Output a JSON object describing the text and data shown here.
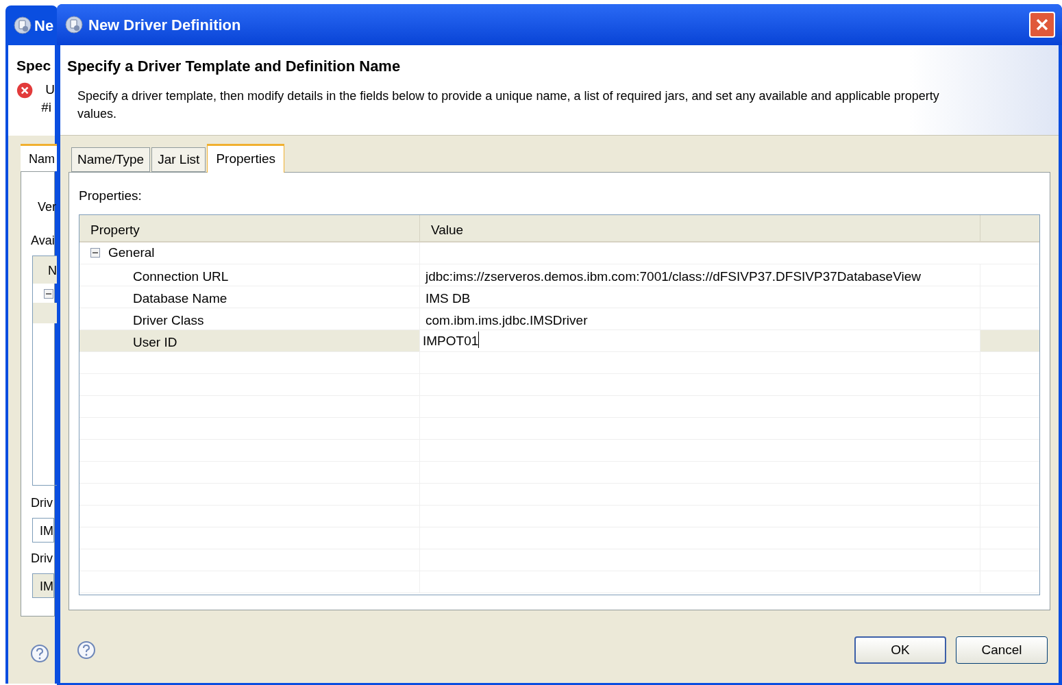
{
  "background_window": {
    "title": "Ne",
    "heading": "Spec",
    "message_lines": [
      "U",
      "#i"
    ],
    "tab": "Nam",
    "label_1": "Ver",
    "label_2": "Avai",
    "table_header": "N",
    "field_label_1": "Driv",
    "field_value_1": "IM",
    "field_label_2": "Driv",
    "field_value_2": "IM"
  },
  "window": {
    "title": "New Driver Definition"
  },
  "header": {
    "title": "Specify a Driver Template and Definition Name",
    "description": "Specify a driver template, then modify details in the fields below to provide a unique name, a list of required jars, and set any available and applicable property values."
  },
  "tabs": [
    {
      "label": "Name/Type",
      "selected": false
    },
    {
      "label": "Jar List",
      "selected": false
    },
    {
      "label": "Properties",
      "selected": true
    }
  ],
  "properties_label": "Properties:",
  "table": {
    "columns": [
      "Property",
      "Value"
    ],
    "groups": [
      {
        "name": "General",
        "expanded": true,
        "children": [
          {
            "name": "Connection URL",
            "value": "jdbc:ims://zserveros.demos.ibm.com:7001/class://dFSIVP37.DFSIVP37DatabaseView",
            "selected": false
          },
          {
            "name": "Database Name",
            "value": "IMS DB",
            "selected": false
          },
          {
            "name": "Driver Class",
            "value": "com.ibm.ims.jdbc.IMSDriver",
            "selected": false
          },
          {
            "name": "User ID",
            "value": "IMPOT01",
            "selected": true
          }
        ]
      }
    ]
  },
  "buttons": [
    "OK",
    "Cancel"
  ]
}
